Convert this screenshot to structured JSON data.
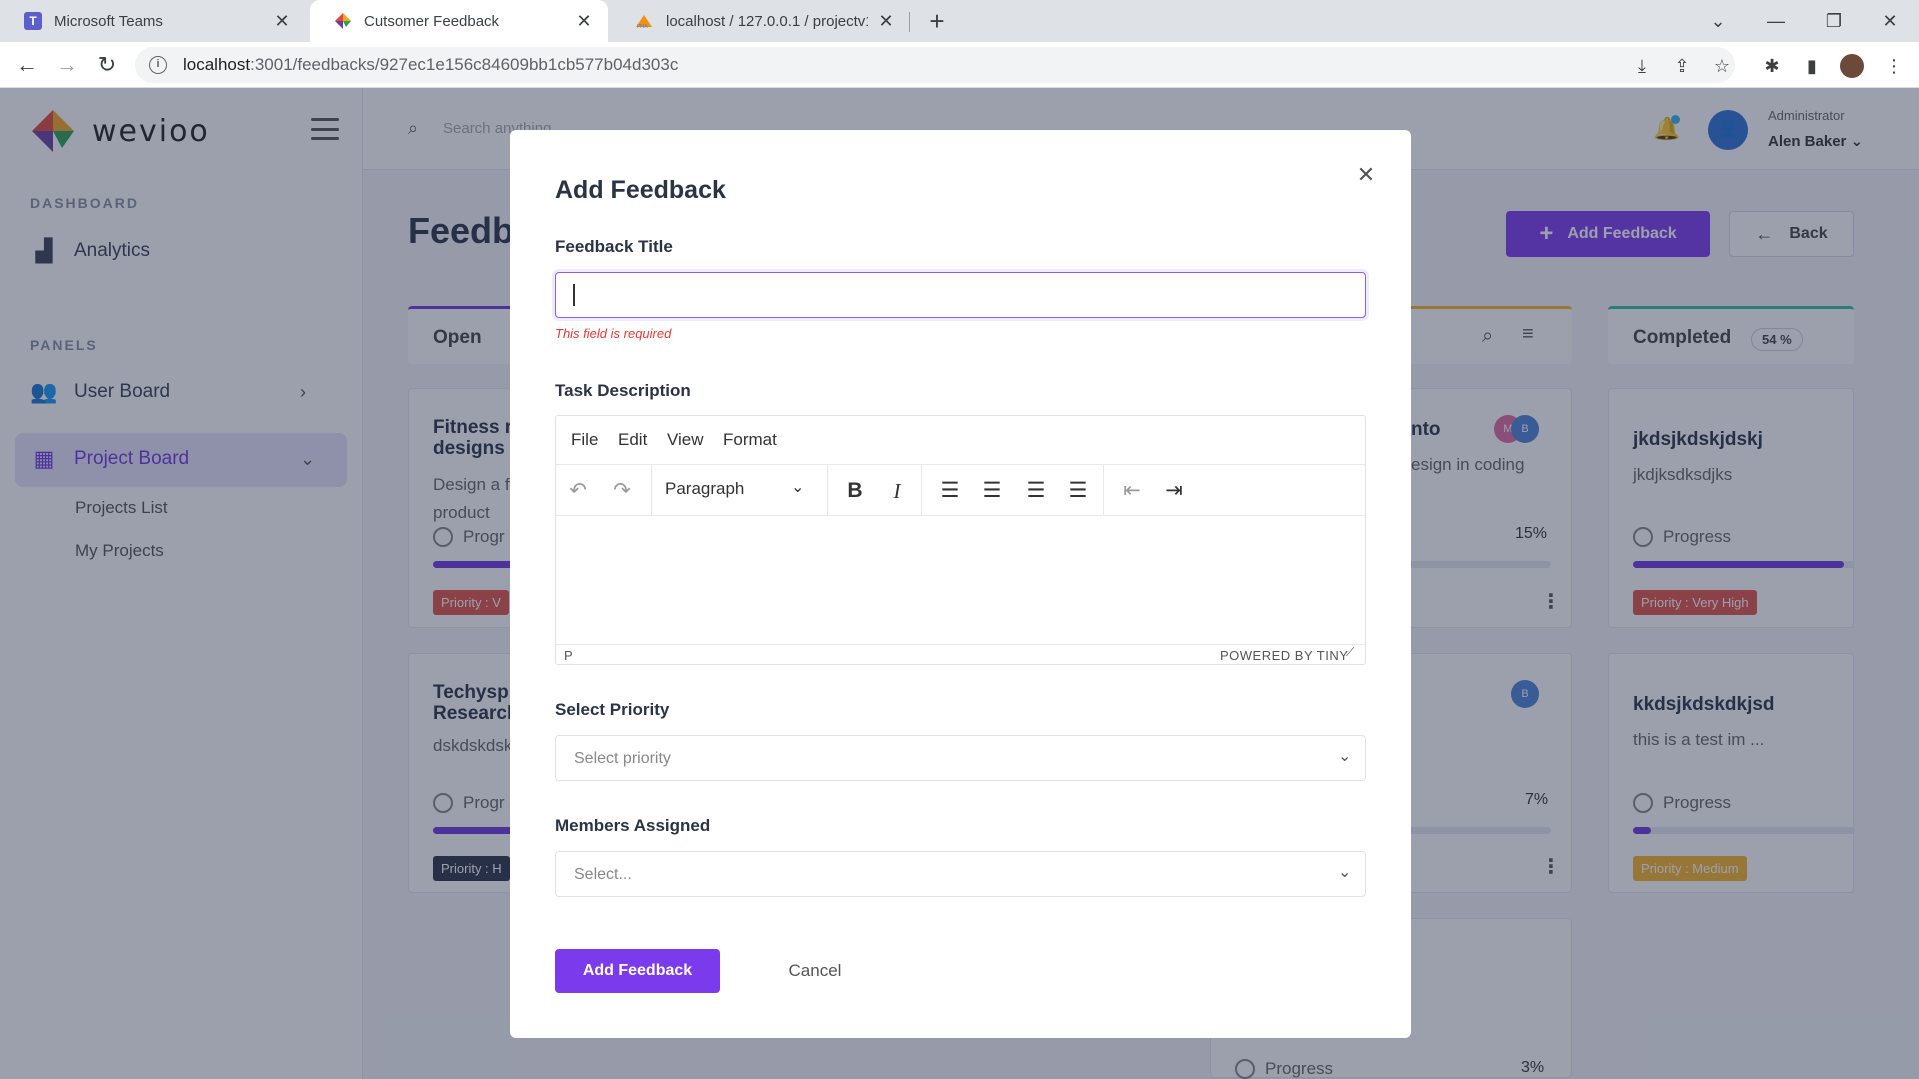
{
  "browser": {
    "tabs": [
      {
        "title": "Microsoft Teams",
        "icon": "teams-icon"
      },
      {
        "title": "Cutsomer Feedback",
        "icon": "wevioo-favicon"
      },
      {
        "title": "localhost / 127.0.0.1 / projectv1 /",
        "icon": "phpmyadmin-icon"
      }
    ],
    "url_host": "localhost",
    "url_path": ":3001/feedbacks/927ec1e156c84609bb1cb577b04d303c"
  },
  "sidebar": {
    "logo_text": "wevioo",
    "section_dashboard": "DASHBOARD",
    "analytics_label": "Analytics",
    "section_panels": "PANELS",
    "user_board_label": "User Board",
    "project_board_label": "Project Board",
    "projects_list_label": "Projects List",
    "my_projects_label": "My Projects"
  },
  "topbar": {
    "search_placeholder": "Search anything...",
    "user_role": "Administrator",
    "user_name": "Alen Baker"
  },
  "page": {
    "title": "Feedb",
    "add_feedback_label": "Add Feedback",
    "back_label": "Back"
  },
  "columns": {
    "open": {
      "title": "Open"
    },
    "completed": {
      "title": "Completed",
      "percent": "54 %"
    },
    "open_cards": [
      {
        "title": "Fitness r",
        "title2": "designs",
        "desc": "Design a f",
        "desc2": "product",
        "progress": "Progr",
        "priority": "Priority : V"
      },
      {
        "title": "Techysp",
        "title2": "Research",
        "desc": "dskdskdsk",
        "progress": "Progr",
        "priority": "Priority : H"
      }
    ],
    "middle_cards": [
      {
        "title_frag": "nto",
        "desc": "esign in coding",
        "percent": "15%"
      },
      {
        "percent": "7%"
      },
      {
        "progress": "Progress",
        "percent": "3%"
      }
    ],
    "completed_cards": [
      {
        "title": "jkdsjkdskjdskj",
        "desc": "jkdjksdksdjks",
        "progress": "Progress",
        "priority": "Priority : Very High",
        "progress_fraction": 0.95
      },
      {
        "title": "kkdsjkdskdkjsd",
        "desc": "this is a test im ...",
        "progress": "Progress",
        "priority": "Priority : Medium",
        "progress_fraction": 0.08
      }
    ]
  },
  "modal": {
    "title": "Add Feedback",
    "feedback_title_label": "Feedback Title",
    "feedback_title_value": "",
    "error_text": "This field is required",
    "task_description_label": "Task Description",
    "editor_menu": [
      "File",
      "Edit",
      "View",
      "Format"
    ],
    "block_format": "Paragraph",
    "status_path": "P",
    "powered_by": "POWERED BY TINY",
    "select_priority_label": "Select Priority",
    "select_priority_placeholder": "Select priority",
    "members_label": "Members Assigned",
    "members_placeholder": "Select...",
    "submit_label": "Add Feedback",
    "cancel_label": "Cancel"
  },
  "colors": {
    "accent": "#7c3aed",
    "error": "#e53935",
    "overlay": "rgba(35,45,70,0.45)"
  }
}
